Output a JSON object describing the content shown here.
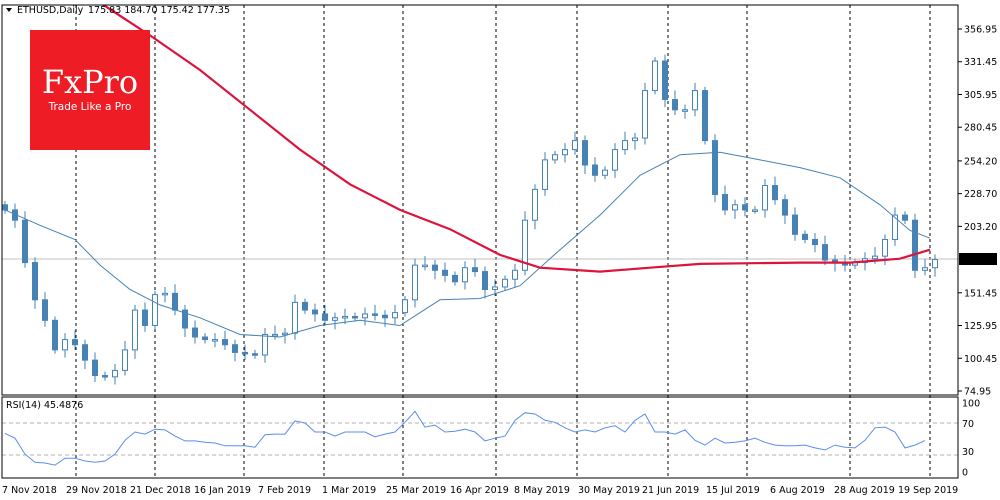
{
  "header": {
    "symbol": "ETHUSD,Daily",
    "ohlc": "175.83 184.70 175.42 177.35"
  },
  "logo": {
    "brand": "FxPro",
    "tagline": "Trade Like a Pro",
    "color": "#ee1c25"
  },
  "colors": {
    "candle": "#4682b4",
    "ma_fast": "#4682b4",
    "ma_slow": "#dc143c",
    "rsi": "#5b8def",
    "current_price_bg": "#000000"
  },
  "chart_data": [
    {
      "type": "candlestick",
      "title": "ETHUSD,Daily",
      "current_price": "177.35",
      "ylim": [
        74.95,
        356.95
      ],
      "y_ticks": [
        "356.95",
        "331.45",
        "305.95",
        "280.45",
        "254.20",
        "228.70",
        "203.20",
        "151.45",
        "125.95",
        "100.45",
        "74.95"
      ],
      "x_tick_labels": [
        "7 Nov 2018",
        "29 Nov 2018",
        "21 Dec 2018",
        "16 Jan 2019",
        "7 Feb 2019",
        "1 Mar 2019",
        "25 Mar 2019",
        "16 Apr 2019",
        "8 May 2019",
        "30 May 2019",
        "21 Jun 2019",
        "15 Jul 2019",
        "6 Aug 2019",
        "28 Aug 2019",
        "19 Sep 2019"
      ],
      "closes": [
        216,
        208,
        175,
        146,
        130,
        107,
        115,
        111,
        99,
        87,
        86,
        91,
        107,
        138,
        126,
        150,
        151,
        138,
        124,
        117,
        115,
        115,
        111,
        105,
        104,
        103,
        119,
        119,
        120,
        144,
        138,
        135,
        130,
        132,
        133,
        132,
        135,
        134,
        132,
        136,
        146,
        173,
        173,
        169,
        165,
        160,
        171,
        168,
        154,
        156,
        162,
        169,
        208,
        232,
        255,
        259,
        263,
        270,
        251,
        243,
        247,
        263,
        270,
        272,
        309,
        332,
        302,
        294,
        294,
        309,
        270,
        228,
        216,
        220,
        216,
        216,
        235,
        224,
        212,
        197,
        193,
        189,
        177,
        175,
        173,
        175,
        178,
        180,
        193,
        212,
        208,
        169,
        171,
        177.35
      ],
      "series": [
        {
          "name": "MA fast",
          "points": [
            [
              0,
              216
            ],
            [
              3.5,
              204
            ],
            [
              7,
              193
            ],
            [
              9.5,
              173
            ],
            [
              12.5,
              154
            ],
            [
              15.5,
              142
            ],
            [
              19.5,
              132
            ],
            [
              23.5,
              119
            ],
            [
              27.5,
              117
            ],
            [
              31.5,
              126
            ],
            [
              35.5,
              130
            ],
            [
              39.5,
              126
            ],
            [
              43.5,
              146
            ],
            [
              47.5,
              147
            ],
            [
              51.5,
              157
            ],
            [
              55.5,
              185
            ],
            [
              59.5,
              212
            ],
            [
              63.5,
              243
            ],
            [
              67.5,
              259
            ],
            [
              71.5,
              261
            ],
            [
              75.5,
              255
            ],
            [
              79.5,
              249
            ],
            [
              83.5,
              241
            ],
            [
              87.5,
              220
            ],
            [
              90.5,
              200
            ],
            [
              92.5,
              194
            ]
          ]
        },
        {
          "name": "MA slow",
          "points": [
            [
              9,
              380
            ],
            [
              14.5,
              352
            ],
            [
              19.5,
              325
            ],
            [
              24.5,
              294
            ],
            [
              29.5,
              263
            ],
            [
              34.5,
              236
            ],
            [
              39.5,
              216
            ],
            [
              44.5,
              201
            ],
            [
              49.5,
              181
            ],
            [
              53.5,
              171
            ],
            [
              59.5,
              168
            ],
            [
              64.5,
              171
            ],
            [
              69.5,
              174
            ],
            [
              79.5,
              175
            ],
            [
              84.5,
              175
            ],
            [
              89.5,
              178
            ],
            [
              92.5,
              185
            ]
          ]
        }
      ]
    },
    {
      "type": "line",
      "title": "RSI(14) 45.4876",
      "ylim": [
        0,
        100
      ],
      "y_ticks": [
        "100",
        "70",
        "30",
        "0"
      ],
      "levels": [
        70,
        30
      ],
      "values": [
        56,
        49,
        26,
        14,
        13,
        10,
        20,
        20,
        16,
        14,
        16,
        26,
        46,
        58,
        55,
        62,
        61,
        52,
        45,
        45,
        43,
        42,
        38,
        38,
        38,
        36,
        54,
        55,
        55,
        74,
        71,
        58,
        58,
        52,
        58,
        58,
        58,
        51,
        55,
        58,
        72,
        88,
        65,
        68,
        58,
        59,
        62,
        58,
        45,
        49,
        52,
        75,
        86,
        84,
        75,
        72,
        64,
        58,
        61,
        58,
        64,
        67,
        58,
        75,
        84,
        58,
        58,
        55,
        61,
        46,
        39,
        49,
        42,
        43,
        45,
        49,
        43,
        39,
        38,
        38,
        39,
        35,
        32,
        39,
        36,
        35,
        46,
        64,
        65,
        58,
        35,
        39,
        45.5
      ]
    }
  ]
}
